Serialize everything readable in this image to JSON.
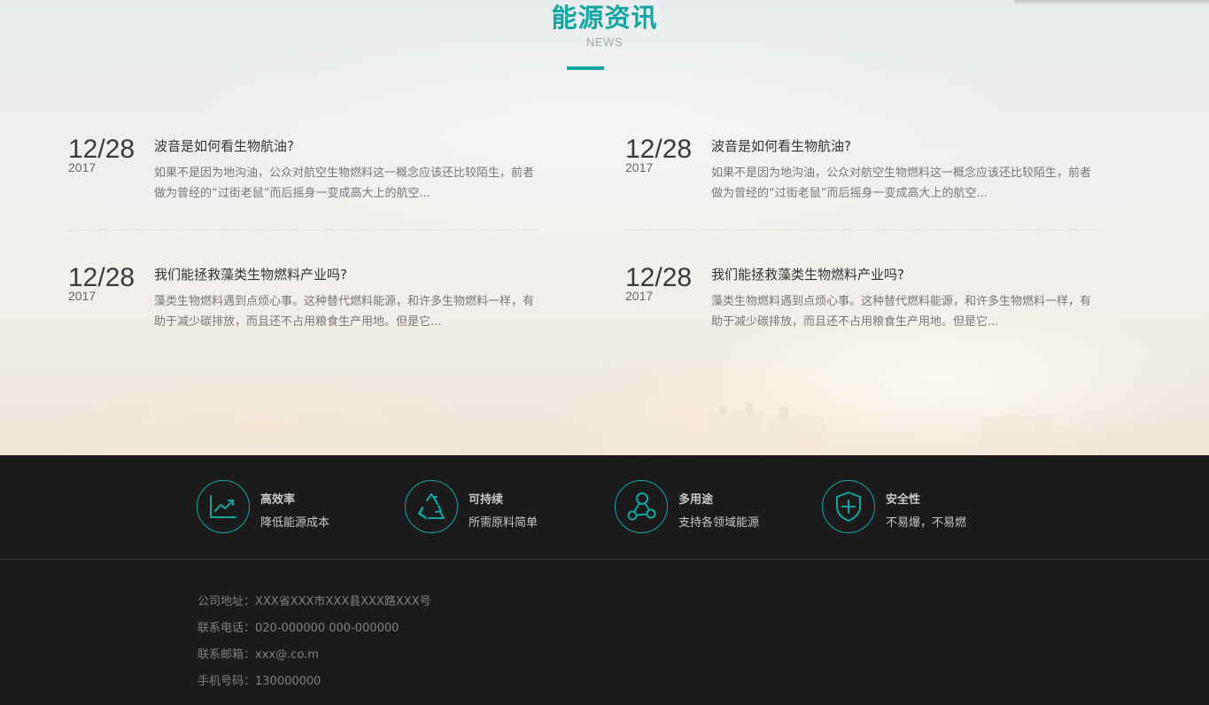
{
  "news_section": {
    "title": "能源资讯",
    "subtitle": "NEWS",
    "items": [
      {
        "day": "12/28",
        "year": "2017",
        "title": "波音是如何看生物航油?",
        "desc": "如果不是因为地沟油，公众对航空生物燃料这一概念应该还比较陌生，前者做为曾经的“过街老鼠”而后摇身一变成高大上的航空..."
      },
      {
        "day": "12/28",
        "year": "2017",
        "title": "波音是如何看生物航油?",
        "desc": "如果不是因为地沟油，公众对航空生物燃料这一概念应该还比较陌生，前者做为曾经的“过街老鼠”而后摇身一变成高大上的航空..."
      },
      {
        "day": "12/28",
        "year": "2017",
        "title": "我们能拯救藻类生物燃料产业吗?",
        "desc": "藻类生物燃料遇到点烦心事。这种替代燃料能源，和许多生物燃料一样，有助于减少碳排放，而且还不占用粮食生产用地。但是它..."
      },
      {
        "day": "12/28",
        "year": "2017",
        "title": "我们能拯救藻类生物燃料产业吗?",
        "desc": "藻类生物燃料遇到点烦心事。这种替代燃料能源，和许多生物燃料一样，有助于减少碳排放，而且还不占用粮食生产用地。但是它..."
      }
    ]
  },
  "features": [
    {
      "icon": "line-chart-icon",
      "title": "高效率",
      "desc": "降低能源成本"
    },
    {
      "icon": "recycle-icon",
      "title": "可持续",
      "desc": "所需原料简单"
    },
    {
      "icon": "share-nodes-icon",
      "title": "多用途",
      "desc": "支持各领域能源"
    },
    {
      "icon": "shield-plus-icon",
      "title": "安全性",
      "desc": "不易爆，不易燃"
    }
  ],
  "contact": {
    "address": "公司地址：XXX省XXX市XXX县XXX路XXX号",
    "phone": "联系电话：020-000000 000-000000",
    "email": "联系邮箱：xxx@.co.m",
    "mobile": "手机号码：130000000"
  },
  "colors": {
    "accent": "#13a6a3",
    "footer_bg": "#1b1b1b"
  }
}
